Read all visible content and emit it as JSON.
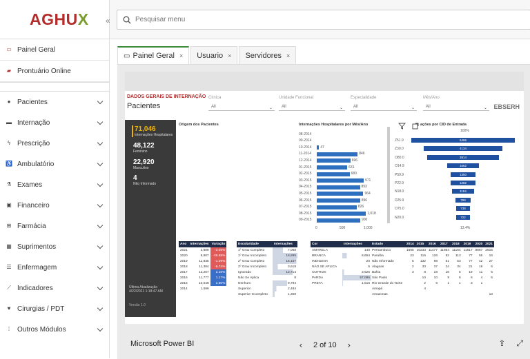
{
  "logo": {
    "main": "AGHU",
    "accent": "X"
  },
  "search": {
    "placeholder": "Pesquisar menu"
  },
  "nav_top": [
    {
      "label": "Painel Geral",
      "icon": "monitor-icon"
    },
    {
      "label": "Prontuário Online",
      "icon": "folder-icon"
    }
  ],
  "nav": [
    {
      "label": "Pacientes",
      "icon": "user-icon"
    },
    {
      "label": "Internação",
      "icon": "bed-icon"
    },
    {
      "label": "Prescrição",
      "icon": "stethoscope-icon"
    },
    {
      "label": "Ambulatório",
      "icon": "wheelchair-icon"
    },
    {
      "label": "Exames",
      "icon": "flask-icon"
    },
    {
      "label": "Financeiro",
      "icon": "money-icon"
    },
    {
      "label": "Farmácia",
      "icon": "plus-square-icon"
    },
    {
      "label": "Suprimentos",
      "icon": "box-icon"
    },
    {
      "label": "Enfermagem",
      "icon": "list-icon"
    },
    {
      "label": "Indicadores",
      "icon": "chart-line-icon"
    },
    {
      "label": "Cirurgias / PDT",
      "icon": "heartbeat-icon"
    },
    {
      "label": "Outros Módulos",
      "icon": "grid-icon"
    }
  ],
  "tabs": [
    {
      "label": "Painel Geral",
      "close": "×"
    },
    {
      "label": "Usuario",
      "close": "×"
    },
    {
      "label": "Servidores",
      "close": "×"
    }
  ],
  "report": {
    "header_small": "DADOS GERAIS DE INTERNAÇÃO",
    "header_big": "Pacientes",
    "brand": "EBSERH",
    "filters": [
      {
        "label": "Clínica",
        "value": "All"
      },
      {
        "label": "Unidade Funcional",
        "value": "All"
      },
      {
        "label": "Especialidade",
        "value": "All"
      },
      {
        "label": "Mês/Ano",
        "value": "All"
      }
    ],
    "kpis": [
      {
        "value": "71,046",
        "label": "Internações Hospitalares"
      },
      {
        "value": "48,122",
        "label": "Feminino"
      },
      {
        "value": "22,920",
        "label": "Masculino"
      },
      {
        "value": "4",
        "label": "Não Informado"
      }
    ],
    "last_update_label": "Última Atualização",
    "last_update": "4/22/2021 1:18:47 AM",
    "version": "Versão 1.0",
    "origin_title": "Origem dos Pacientes",
    "bar_title": "Internações Hospitalares por Mês/Ano",
    "funnel_title": "ações por CID de Entrada",
    "funnel_top": "100%",
    "funnel_bottom": "13.4%"
  },
  "chart_data": [
    {
      "type": "bar",
      "title": "Internações Hospitalares por Mês/Ano",
      "categories": [
        "08-2014",
        "09-2014",
        "10-2014",
        "11-2014",
        "12-2014",
        "01-2015",
        "02-2015",
        "03-2015",
        "04-2015",
        "05-2015",
        "06-2015",
        "07-2015",
        "08-2015",
        "09-2015"
      ],
      "values": [
        null,
        null,
        47,
        846,
        696,
        631,
        680,
        971,
        893,
        964,
        896,
        826,
        1018,
        900
      ],
      "value_labels": [
        "",
        "",
        "47",
        "846",
        "696",
        "631",
        "680",
        "971",
        "893",
        "964",
        "896",
        "826",
        "1,018",
        "900"
      ],
      "xticks": [
        "0",
        "500",
        "1,000"
      ],
      "xlim": [
        0,
        1000
      ]
    },
    {
      "type": "bar",
      "title": "ações por CID de Entrada",
      "categories": [
        "Z51.9",
        "Z30.0",
        "O80.0",
        "O14.9",
        "P59.9",
        "P22.9",
        "N18.0",
        "D25.9",
        "O75.0",
        "N20.0"
      ],
      "values": [
        5486,
        4134,
        3814,
        1662,
        1350,
        1282,
        1194,
        799,
        739,
        722
      ]
    }
  ],
  "tables": {
    "ano": {
      "headers": [
        "Ano",
        "Internações",
        "Variação"
      ],
      "rows": [
        [
          "2021",
          "2,889",
          "-3.25%"
        ],
        [
          "2020",
          "8,807",
          "-25.59%"
        ],
        [
          "2019",
          "11,835",
          "-1.39%"
        ],
        [
          "2018",
          "11,384",
          "-6.74%"
        ],
        [
          "2017",
          "12,207",
          "2.16%"
        ],
        [
          "2016",
          "11,777",
          "1.17%"
        ],
        [
          "2015",
          "10,548",
          "2.50%"
        ],
        [
          "2014",
          "1,599",
          ""
        ]
      ]
    },
    "escolaridade": {
      "headers": [
        "Escolaridade",
        "Internações"
      ],
      "rows": [
        [
          "1º Grau Completo",
          "7,058"
        ],
        [
          "1º Grau Incompleto",
          "16,895"
        ],
        [
          "2º Grau Completo",
          "16,107"
        ],
        [
          "2º Grau Incompleto",
          "3,618"
        ],
        [
          "Ignorado",
          "13,714"
        ],
        [
          "Não Se Aplica",
          "8"
        ],
        [
          "Nenhum",
          "9,794"
        ],
        [
          "Superior",
          "2,484"
        ],
        [
          "Superior Incompleto",
          "1,308"
        ]
      ]
    },
    "cor": {
      "headers": [
        "Cor",
        "Internações"
      ],
      "rows": [
        [
          "AMARELA",
          "140"
        ],
        [
          "BRANCA",
          "8,654"
        ],
        [
          "INDIGENA",
          "20"
        ],
        [
          "NÃO SE APLICA",
          "5"
        ],
        [
          "OUTROS",
          "3,625"
        ],
        [
          "PARDA",
          "57,086"
        ],
        [
          "PRETA",
          "1,516"
        ]
      ]
    },
    "estado": {
      "headers": [
        "Estado",
        "2014",
        "2015",
        "2016",
        "2017",
        "2018",
        "2019",
        "2020",
        "2021"
      ],
      "rows": [
        [
          "Pernambuco",
          "1565",
          "10233",
          "11477",
          "11864",
          "11164",
          "11617",
          "8667",
          "2815"
        ],
        [
          "Paraíba",
          "23",
          "116",
          "126",
          "82",
          "113",
          "77",
          "55",
          "16"
        ],
        [
          "Não Informado",
          "5",
          "132",
          "98",
          "61",
          "53",
          "77",
          "42",
          "27"
        ],
        [
          "Alagoas",
          "2",
          "33",
          "37",
          "24",
          "34",
          "21",
          "18",
          "5"
        ],
        [
          "Bahia",
          "3",
          "8",
          "18",
          "18",
          "5",
          "19",
          "11",
          "5"
        ],
        [
          "São Paulo",
          "",
          "10",
          "10",
          "9",
          "6",
          "6",
          "4",
          "5"
        ],
        [
          "Rio Grande do Norte",
          "",
          "2",
          "6",
          "1",
          "1",
          "3",
          "1",
          ""
        ],
        [
          "Amapá",
          "",
          "4",
          "",
          "",
          "",
          "",
          "",
          ""
        ],
        [
          "Amazonas",
          "",
          "",
          "",
          "",
          "",
          "",
          "",
          "13"
        ]
      ]
    }
  },
  "footer": {
    "brand": "Microsoft Power BI",
    "page": "2 of 10",
    "prev": "‹",
    "next": "›"
  },
  "colors": {
    "accent_red": "#b42d2d",
    "accent_green": "#7a9e2d",
    "bar_blue": "#2f6fbf",
    "funnel_blue": "#2050a0",
    "kpi_yellow": "#f0b400"
  }
}
